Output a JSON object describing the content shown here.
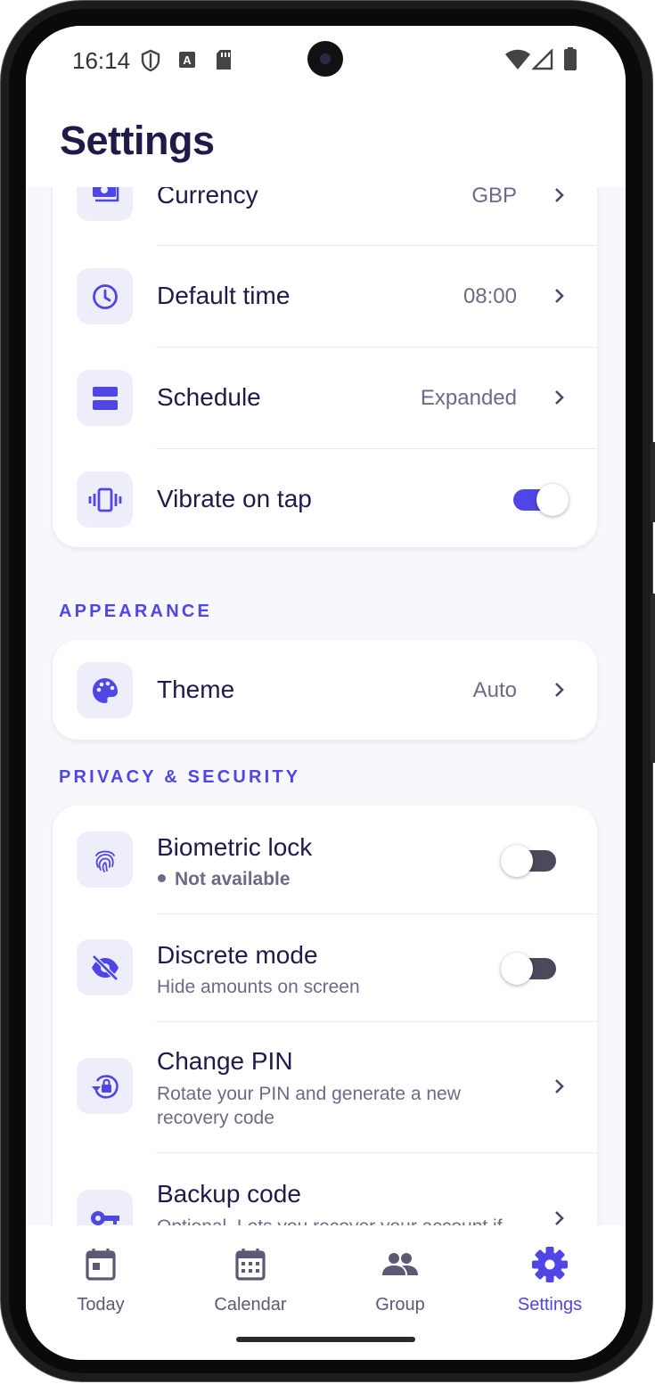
{
  "status_bar": {
    "time": "16:14"
  },
  "header": {
    "title": "Settings"
  },
  "general": {
    "currency": {
      "label": "Currency",
      "value": "GBP"
    },
    "default_time": {
      "label": "Default time",
      "value": "08:00"
    },
    "schedule": {
      "label": "Schedule",
      "value": "Expanded"
    },
    "vibrate": {
      "label": "Vibrate on tap",
      "enabled": true
    }
  },
  "appearance": {
    "section_label": "APPEARANCE",
    "theme": {
      "label": "Theme",
      "value": "Auto"
    }
  },
  "privacy": {
    "section_label": "PRIVACY & SECURITY",
    "biometric": {
      "label": "Biometric lock",
      "status": "Not available",
      "enabled": false
    },
    "discrete": {
      "label": "Discrete mode",
      "description": "Hide amounts on screen",
      "enabled": false
    },
    "change_pin": {
      "label": "Change PIN",
      "description": "Rotate your PIN and generate a new recovery code"
    },
    "backup": {
      "label": "Backup code",
      "description": "Optional. Lets you recover your account if you forget your PIN"
    }
  },
  "nav": {
    "today": "Today",
    "calendar": "Calendar",
    "group": "Group",
    "settings": "Settings",
    "active": "settings"
  },
  "colors": {
    "accent": "#4f46e5",
    "title": "#1e1b4b",
    "muted": "#6b6b85",
    "icon_bg": "#eeeefa"
  }
}
